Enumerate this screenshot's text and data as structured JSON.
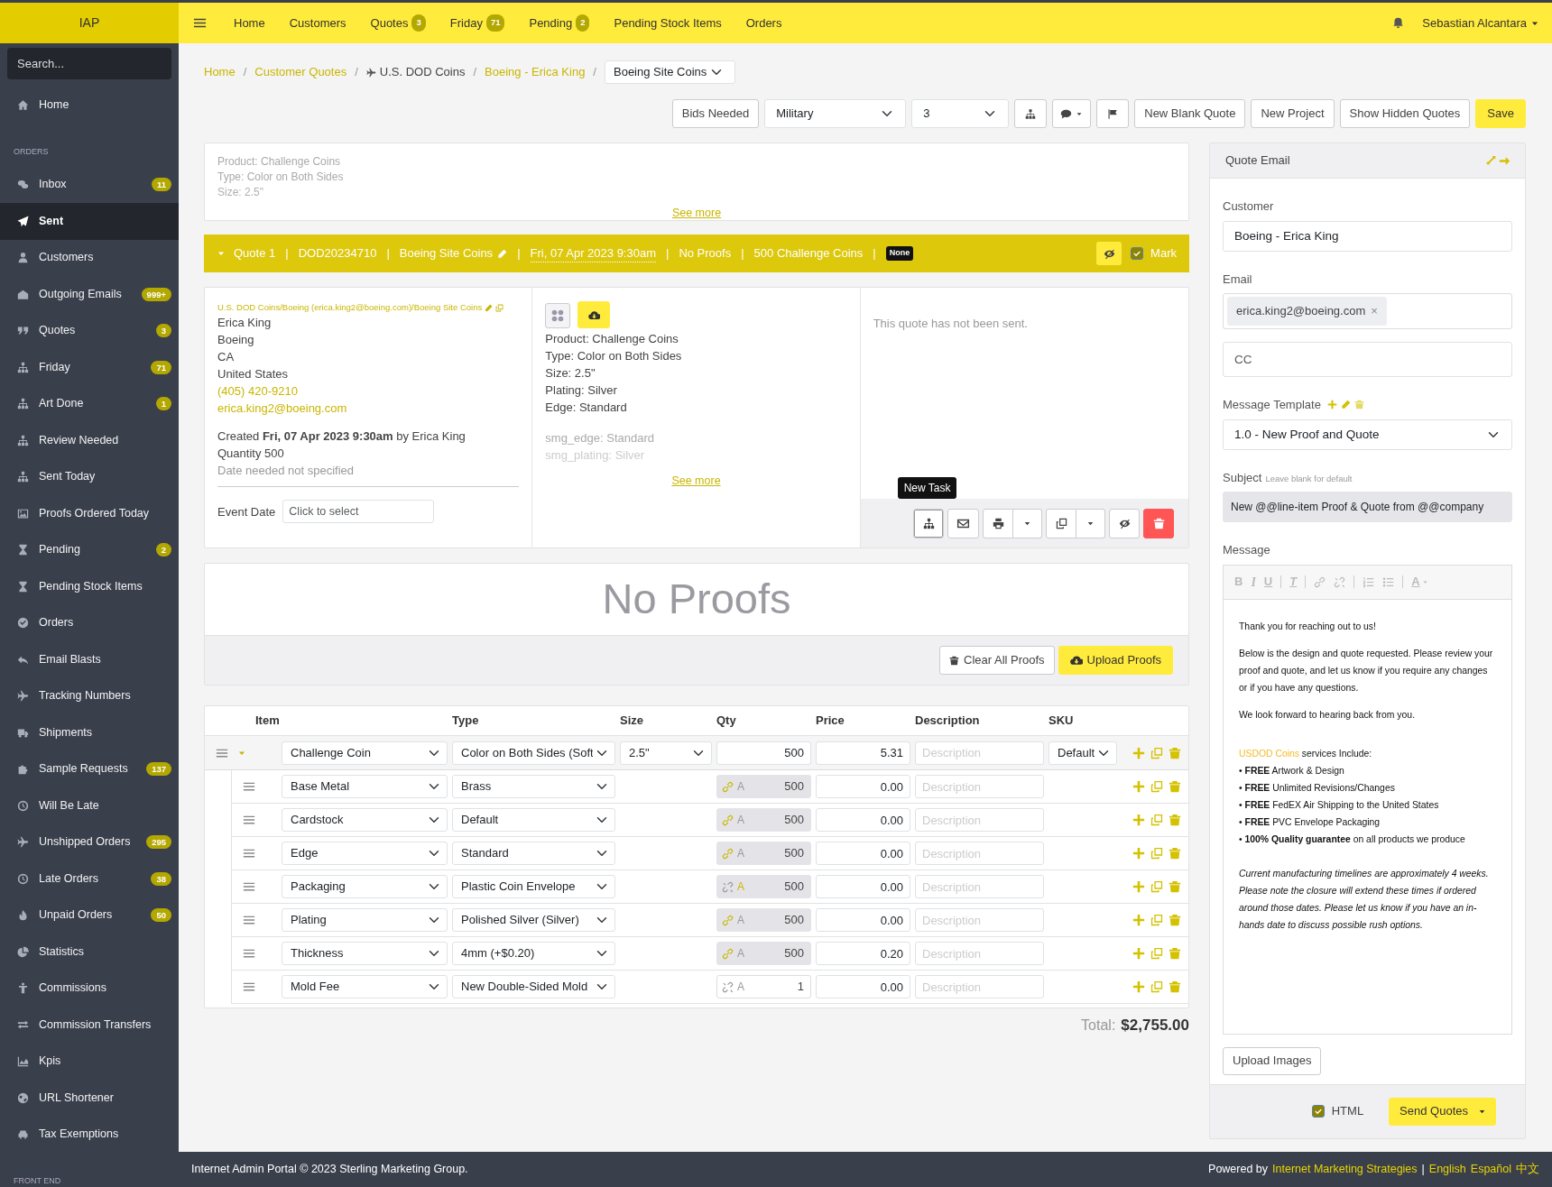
{
  "brand": "IAP",
  "topnav": {
    "items": [
      {
        "label": "Home"
      },
      {
        "label": "Customers"
      },
      {
        "label": "Quotes",
        "badge": "3"
      },
      {
        "label": "Friday",
        "badge": "71"
      },
      {
        "label": "Pending",
        "badge": "2"
      },
      {
        "label": "Pending Stock Items"
      },
      {
        "label": "Orders"
      }
    ],
    "user": "Sebastian Alcantara"
  },
  "sidebar": {
    "search": {
      "placeholder": "Search..."
    },
    "items": [
      {
        "kind": "link",
        "label": "Home",
        "selected": false
      },
      {
        "kind": "heading",
        "label": "ORDERS"
      },
      {
        "kind": "link",
        "label": "Inbox",
        "badge": "11",
        "selected": false
      },
      {
        "kind": "link",
        "label": "Sent",
        "selected": true
      },
      {
        "kind": "link",
        "label": "Customers",
        "selected": false
      },
      {
        "kind": "link",
        "label": "Outgoing Emails",
        "badge": "999+",
        "selected": false
      },
      {
        "kind": "link",
        "label": "Quotes",
        "badge": "3",
        "selected": false
      },
      {
        "kind": "link",
        "label": "Friday",
        "badge": "71",
        "selected": false
      },
      {
        "kind": "link",
        "label": "Art Done",
        "badge": "1",
        "selected": false
      },
      {
        "kind": "link",
        "label": "Review Needed",
        "selected": false
      },
      {
        "kind": "link",
        "label": "Sent Today",
        "selected": false
      },
      {
        "kind": "link",
        "label": "Proofs Ordered Today",
        "selected": false
      },
      {
        "kind": "link",
        "label": "Pending",
        "badge": "2",
        "selected": false
      },
      {
        "kind": "link",
        "label": "Pending Stock Items",
        "selected": false
      },
      {
        "kind": "link",
        "label": "Orders",
        "selected": false
      },
      {
        "kind": "link",
        "label": "Email Blasts",
        "selected": false
      },
      {
        "kind": "link",
        "label": "Tracking Numbers",
        "selected": false
      },
      {
        "kind": "link",
        "label": "Shipments",
        "selected": false
      },
      {
        "kind": "link",
        "label": "Sample Requests",
        "badge": "137",
        "selected": false
      },
      {
        "kind": "link",
        "label": "Will Be Late",
        "selected": false
      },
      {
        "kind": "link",
        "label": "Unshipped Orders",
        "badge": "295",
        "selected": false
      },
      {
        "kind": "link",
        "label": "Late Orders",
        "badge": "38",
        "selected": false
      },
      {
        "kind": "link",
        "label": "Unpaid Orders",
        "badge": "50",
        "selected": false
      },
      {
        "kind": "link",
        "label": "Statistics",
        "selected": false
      },
      {
        "kind": "link",
        "label": "Commissions",
        "selected": false
      },
      {
        "kind": "link",
        "label": "Commission Transfers",
        "selected": false
      },
      {
        "kind": "link",
        "label": "Kpis",
        "selected": false
      },
      {
        "kind": "link",
        "label": "URL Shortener",
        "selected": false
      },
      {
        "kind": "link",
        "label": "Tax Exemptions",
        "selected": false
      },
      {
        "kind": "heading",
        "label": "FRONT END"
      }
    ]
  },
  "breadcrumb": {
    "separator": "/",
    "items": [
      {
        "kind": "link",
        "label": "Home"
      },
      {
        "kind": "link",
        "label": "Customer Quotes"
      },
      {
        "kind": "text",
        "label": "U.S. DOD Coins"
      },
      {
        "kind": "link",
        "label": "Boeing - Erica King"
      },
      {
        "kind": "select",
        "label": "Boeing Site Coins"
      }
    ]
  },
  "toolbar": [
    {
      "kind": "button",
      "label": "Bids Needed"
    },
    {
      "kind": "select",
      "label": "Military"
    },
    {
      "kind": "select",
      "label": "3"
    },
    {
      "kind": "tasks"
    },
    {
      "kind": "comment"
    },
    {
      "kind": "flag"
    },
    {
      "kind": "button",
      "label": "New Blank Quote"
    },
    {
      "kind": "button",
      "label": "New Project"
    },
    {
      "kind": "button",
      "label": "Show Hidden Quotes"
    },
    {
      "kind": "primary",
      "label": "Save"
    }
  ],
  "summary": {
    "lines": [
      "Product: Challenge Coins",
      "Type: Color on Both Sides",
      "Size: 2.5\""
    ],
    "more": "See more"
  },
  "quote_bar": {
    "expanded": true,
    "separator": "|",
    "segments": [
      {
        "kind": "text",
        "text": "Quote 1"
      },
      {
        "kind": "text",
        "text": "DOD20234710"
      },
      {
        "kind": "editable",
        "text": "Boeing Site Coins"
      },
      {
        "kind": "date",
        "text": "Fri, 07 Apr 2023 9:30am"
      },
      {
        "kind": "text",
        "text": "No Proofs"
      },
      {
        "kind": "text",
        "text": "500 Challenge Coins"
      },
      {
        "kind": "badge",
        "text": "None"
      }
    ],
    "mark": {
      "label": "Mark",
      "checked": true
    }
  },
  "details": {
    "customer": {
      "path": "U.S. DOD Coins/Boeing (erica.king2@boeing.com)/Boeing Site Coins",
      "address": [
        "Erica King",
        "Boeing",
        "CA",
        "United States"
      ],
      "phone": "(405) 420-9210",
      "email": "erica.king2@boeing.com",
      "created": "Created **Fri, 07 Apr 2023 9:30am** by Erica King",
      "quantity": "Quantity 500",
      "date_needed": "Date needed not specified",
      "event_date": {
        "label": "Event Date",
        "placeholder": "Click to select"
      }
    },
    "product": {
      "lines": [
        "Product: Challenge Coins",
        "Type: Color on Both Sides",
        "Size: 2.5\"",
        "Plating: Silver",
        "Edge: Standard"
      ],
      "extra_lines": [
        "smg_edge: Standard",
        "smg_plating: Silver"
      ],
      "more": "See more"
    },
    "status": {
      "text": "This quote has not been sent.",
      "tooltip": "New Task"
    }
  },
  "proofs": {
    "empty_text": "No Proofs",
    "buttons": [
      {
        "kind": "clear",
        "label": "Clear All Proofs"
      },
      {
        "kind": "upload",
        "label": "Upload Proofs"
      }
    ]
  },
  "line_items": {
    "columns": [
      "Item",
      "Type",
      "Size",
      "Qty",
      "Price",
      "Description",
      "SKU"
    ],
    "main": {
      "expanded": true,
      "item": "Challenge Coin",
      "type": "Color on Both Sides (Soft",
      "size": "2.5\"",
      "qty": "500",
      "price": "5.31",
      "description": {
        "placeholder": "Description"
      },
      "sku": "Default"
    },
    "rows": [
      {
        "item": "Base Metal",
        "type": "Brass",
        "linked": true,
        "auto": false,
        "locked": true,
        "qty_prefix": "A",
        "qty": "500",
        "price": "0.00",
        "description": {
          "placeholder": "Description"
        }
      },
      {
        "item": "Cardstock",
        "type": "Default",
        "linked": true,
        "auto": false,
        "locked": true,
        "qty_prefix": "A",
        "qty": "500",
        "price": "0.00",
        "description": {
          "placeholder": "Description"
        }
      },
      {
        "item": "Edge",
        "type": "Standard",
        "linked": true,
        "auto": false,
        "locked": true,
        "qty_prefix": "A",
        "qty": "500",
        "price": "0.00",
        "description": {
          "placeholder": "Description"
        }
      },
      {
        "item": "Packaging",
        "type": "Plastic Coin Envelope",
        "linked": false,
        "auto": true,
        "locked": true,
        "qty_prefix": "A",
        "qty": "500",
        "price": "0.00",
        "description": {
          "placeholder": "Description"
        }
      },
      {
        "item": "Plating",
        "type": "Polished Silver (Silver)",
        "linked": true,
        "auto": false,
        "locked": true,
        "qty_prefix": "A",
        "qty": "500",
        "price": "0.00",
        "description": {
          "placeholder": "Description"
        }
      },
      {
        "item": "Thickness",
        "type": "4mm (+$0.20)",
        "linked": true,
        "auto": false,
        "locked": true,
        "qty_prefix": "A",
        "qty": "500",
        "price": "0.20",
        "description": {
          "placeholder": "Description"
        }
      },
      {
        "item": "Mold Fee",
        "type": "New Double-Sided Mold",
        "linked": false,
        "auto": false,
        "locked": false,
        "qty_prefix": "A",
        "qty": "1",
        "price": "0.00",
        "description": {
          "placeholder": "Description"
        }
      }
    ],
    "total_label": "Total:",
    "total": "$2,755.00"
  },
  "email": {
    "title": "Quote Email",
    "customer": {
      "label": "Customer",
      "value": "Boeing - Erica King"
    },
    "email": {
      "label": "Email",
      "tags": [
        {
          "text": "erica.king2@boeing.com",
          "remove": "×"
        }
      ]
    },
    "cc": {
      "placeholder": "CC"
    },
    "template": {
      "label": "Message Template",
      "value": "1.0 - New Proof and Quote"
    },
    "subject": {
      "label": "Subject",
      "hint": "Leave blank for default",
      "value": "New @@line-item Proof & Quote from @@company"
    },
    "message": {
      "label": "Message",
      "toolbar": [
        {
          "kind": "bold",
          "glyph": "B"
        },
        {
          "kind": "italic",
          "glyph": "I"
        },
        {
          "kind": "underline",
          "glyph": "U"
        },
        {
          "kind": "separator"
        },
        {
          "kind": "clear",
          "glyph": "T"
        },
        {
          "kind": "separator"
        },
        {
          "kind": "link"
        },
        {
          "kind": "unlink"
        },
        {
          "kind": "separator"
        },
        {
          "kind": "ol"
        },
        {
          "kind": "ul"
        },
        {
          "kind": "separator"
        },
        {
          "kind": "color",
          "glyph": "A"
        }
      ],
      "paragraphs": [
        {
          "kind": "text",
          "text": "Thank you for reaching out to us!"
        },
        {
          "kind": "text",
          "text": "Below is the design and quote requested. Please review your proof and quote, and let us know if you require any changes or if you have any questions."
        },
        {
          "kind": "text",
          "text": "We look forward to hearing back from you."
        },
        {
          "kind": "lead",
          "highlight": "USDOD Coins",
          "text": " services Include:"
        },
        {
          "kind": "bullet",
          "text": "• **FREE** Artwork & Design"
        },
        {
          "kind": "bullet",
          "text": "• **FREE** Unlimited Revisions/Changes"
        },
        {
          "kind": "bullet",
          "text": "• **FREE** FedEX Air Shipping to the United States"
        },
        {
          "kind": "bullet",
          "text": "• **FREE** PVC Envelope Packaging"
        },
        {
          "kind": "bullet",
          "text": "• **100% Quality guarantee** on all products we produce"
        },
        {
          "kind": "note",
          "text": "Current manufacturing timelines are approximately 4 weeks. Please note the closure will extend these times if ordered around those dates. Please let us know if you have an in-hands date to discuss possible rush options."
        }
      ]
    },
    "upload": "Upload Images",
    "html": {
      "label": "HTML",
      "checked": true
    },
    "send": "Send Quotes"
  },
  "footer": {
    "copyright": "Internet Admin Portal © 2023 Sterling Marketing Group.",
    "powered": "Powered by",
    "company": "Internet Marketing Strategies",
    "divider": "|",
    "languages": [
      "English",
      "Español",
      "中文"
    ]
  }
}
